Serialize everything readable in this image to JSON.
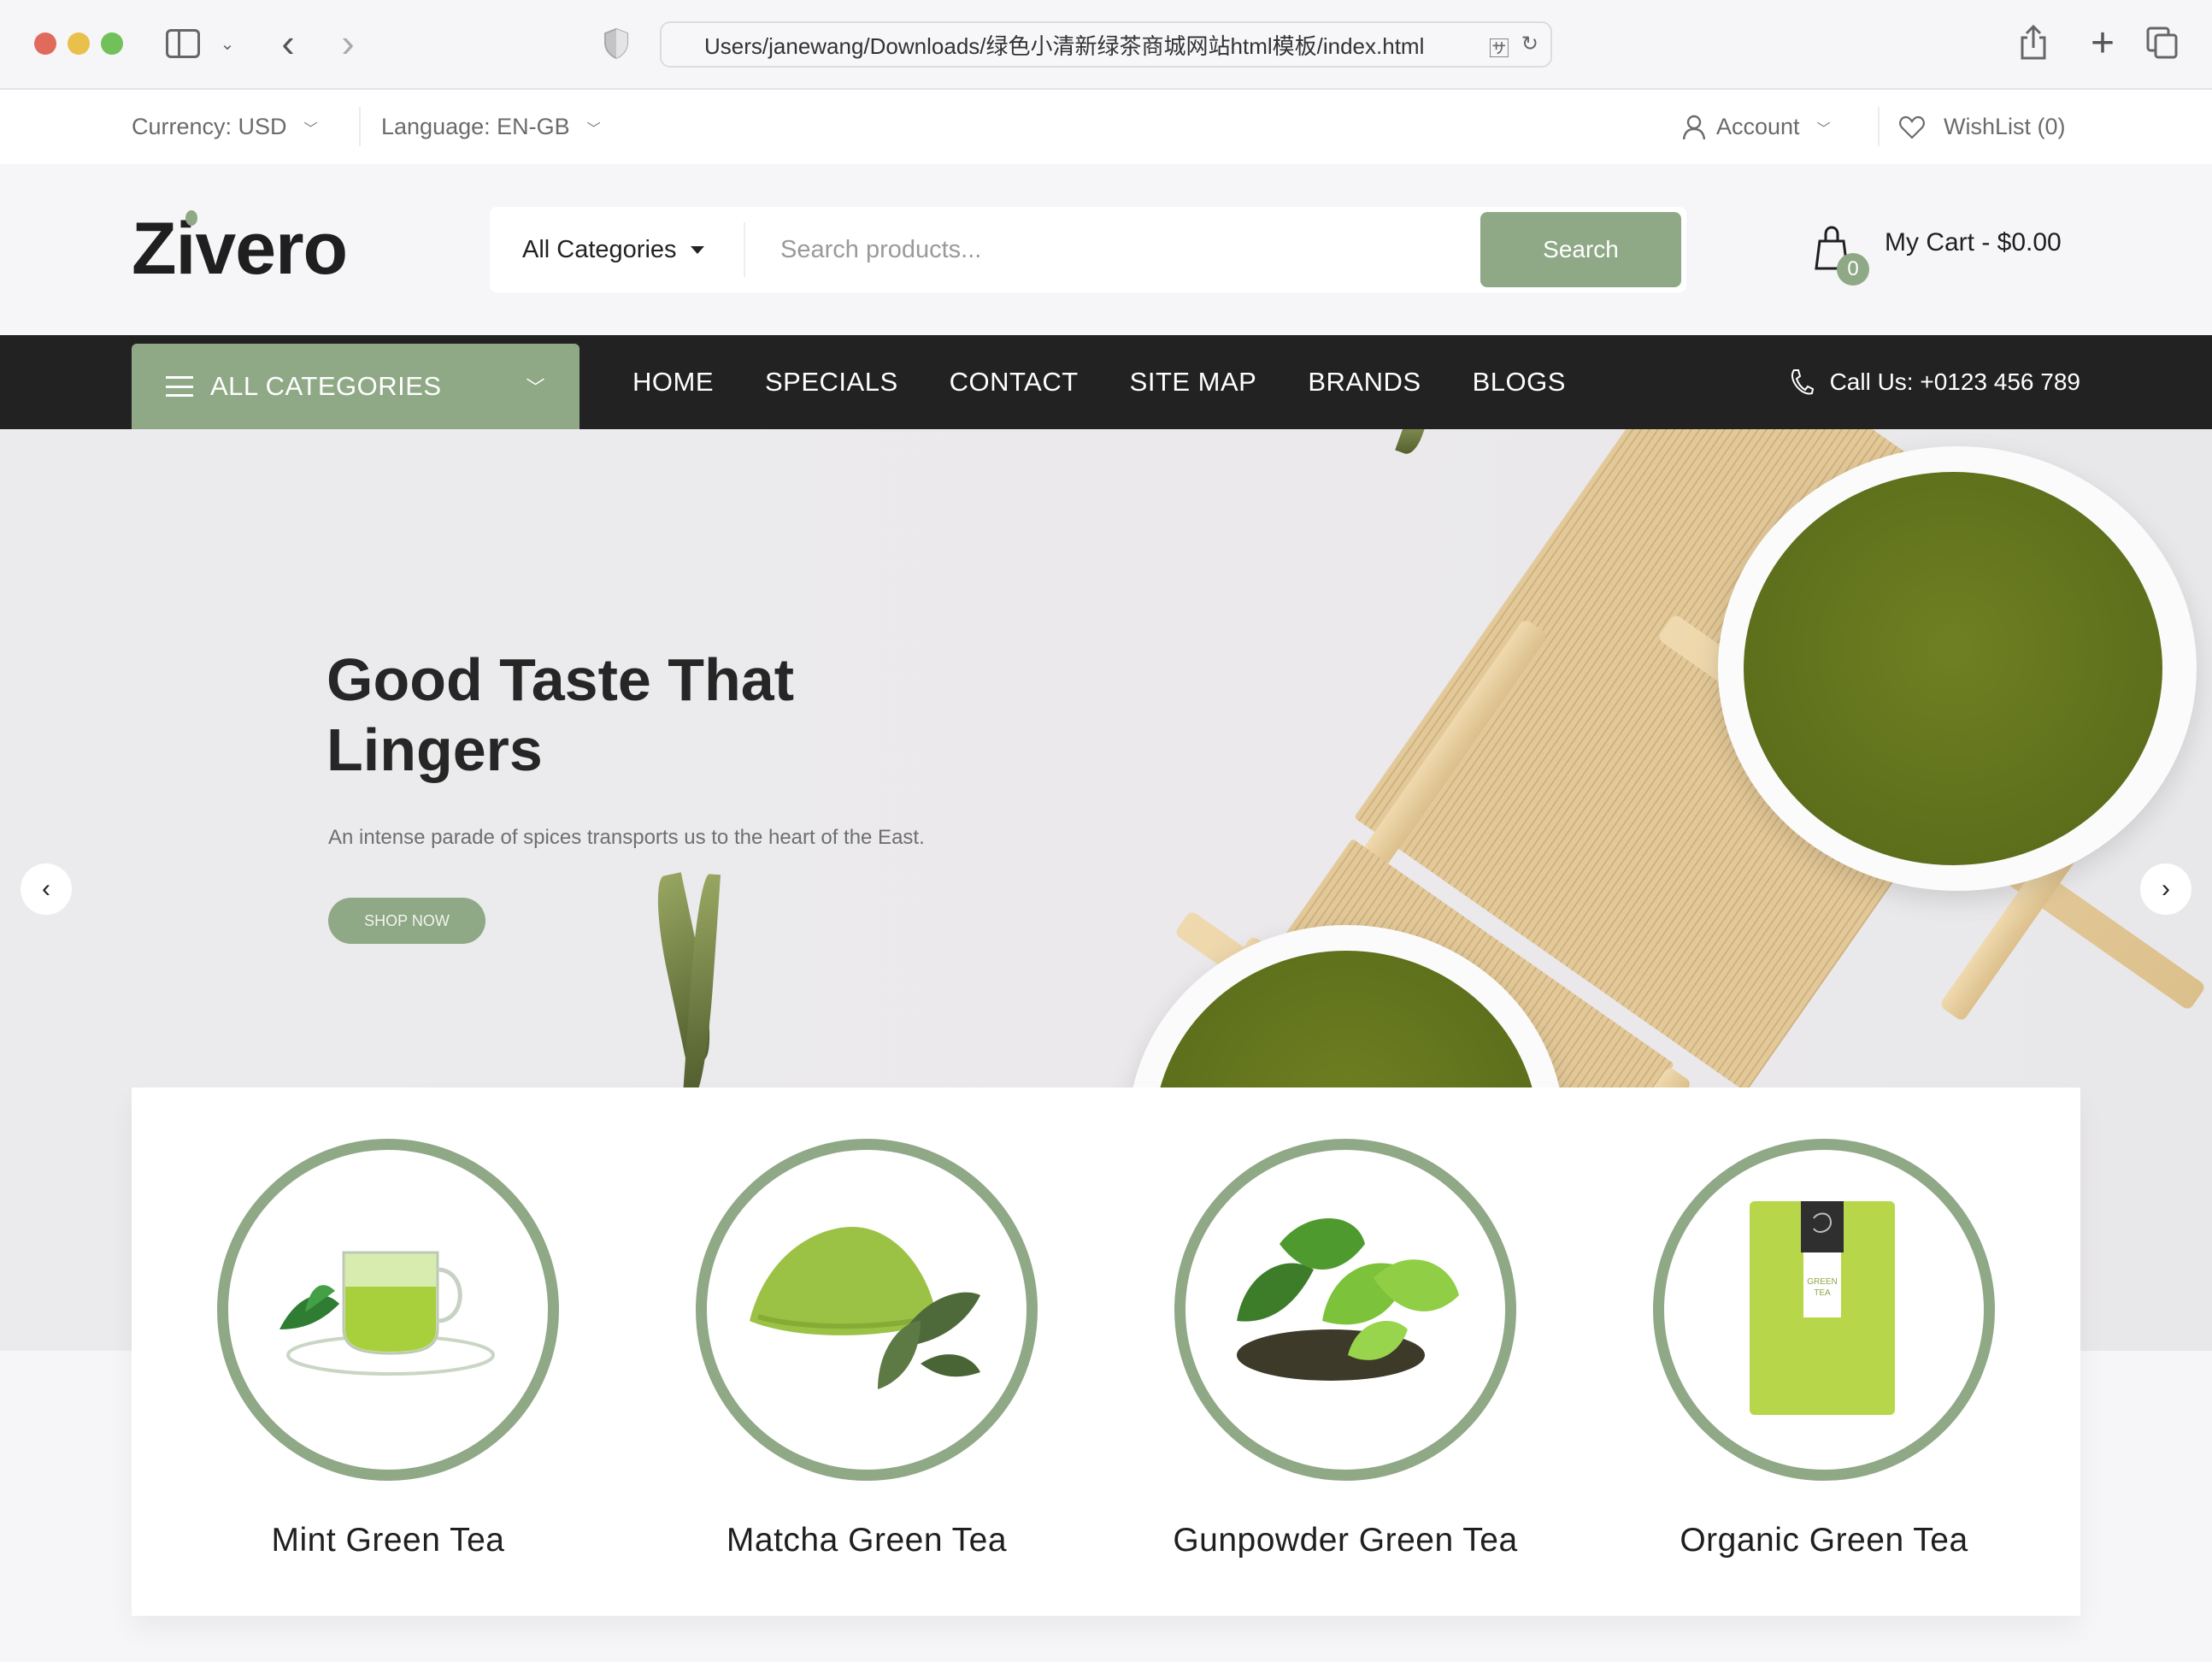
{
  "browser": {
    "url": "Users/janewang/Downloads/绿色小清新绿茶商城网站html模板/index.html",
    "icons": [
      "sidebar-toggle-icon",
      "chevron-down-icon",
      "back-icon",
      "forward-icon",
      "shield-icon",
      "translate-icon",
      "reload-icon",
      "share-icon",
      "new-tab-icon",
      "tabs-overview-icon"
    ]
  },
  "topbar": {
    "currency_label": "Currency: USD",
    "language_label": "Language: EN-GB",
    "account_label": "Account",
    "wishlist_label": "WishList (0)"
  },
  "header": {
    "logo": "Zivero",
    "category_select": "All Categories",
    "search_placeholder": "Search products...",
    "search_button": "Search",
    "cart_count": "0",
    "cart_label": "My Cart - $0.00"
  },
  "nav": {
    "all_categories": "ALL CATEGORIES",
    "links": [
      "HOME",
      "SPECIALS",
      "CONTACT",
      "SITE MAP",
      "BRANDS",
      "BLOGS"
    ],
    "call_us": "Call Us: +0123 456 789"
  },
  "hero": {
    "title_line1": "Good Taste That",
    "title_line2": "Lingers",
    "subtitle": "An intense parade of spices transports us to the heart of the East.",
    "cta": "SHOP NOW",
    "prev_arrow": "‹",
    "next_arrow": "›"
  },
  "categories": [
    {
      "name": "Mint Green Tea",
      "image": "tea-cup-with-mint"
    },
    {
      "name": "Matcha Green Tea",
      "image": "matcha-powder-with-leaves"
    },
    {
      "name": "Gunpowder Green Tea",
      "image": "tea-leaves-with-dried-tea"
    },
    {
      "name": "Organic Green Tea",
      "image": "green-tea-pouch"
    }
  ],
  "colors": {
    "accent": "#8fa886",
    "nav_bg": "#222222",
    "text_dark": "#1f1f1f",
    "muted": "#6b6b6b"
  }
}
